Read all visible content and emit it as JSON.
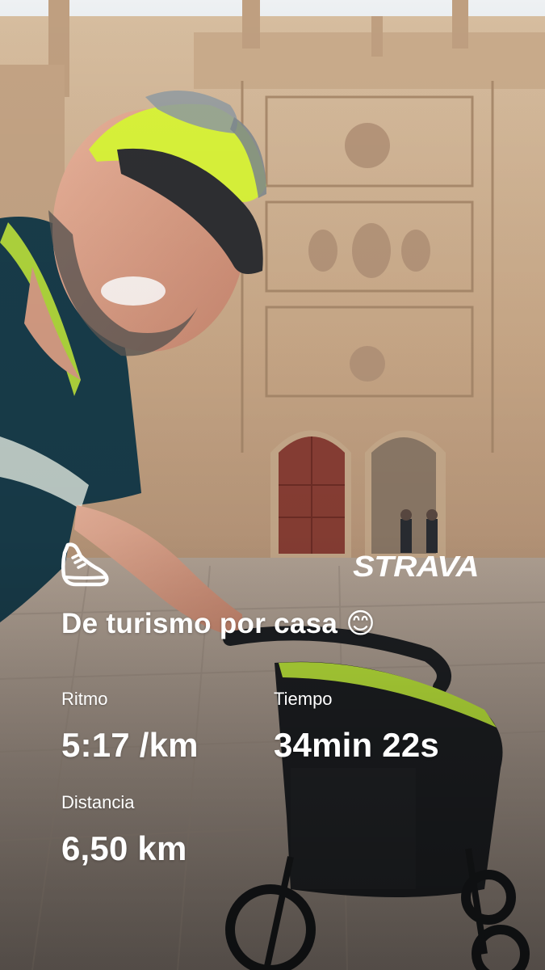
{
  "activity": {
    "title": "De turismo por casa 😊",
    "icon": "running-shoe-icon"
  },
  "brand": {
    "logo_text": "STRAVA"
  },
  "stats": {
    "pace_label": "Ritmo",
    "pace_value": "5:17 /km",
    "time_label": "Tiempo",
    "time_value": "34min 22s",
    "distance_label": "Distancia",
    "distance_value": "6,50 km"
  },
  "colors": {
    "overlay_text": "#ffffff",
    "sky": "#e9ecef",
    "stone": "#d2b89a",
    "door": "#8a3f35",
    "cap": "#d8f23a",
    "shirt": "#183c4a"
  }
}
